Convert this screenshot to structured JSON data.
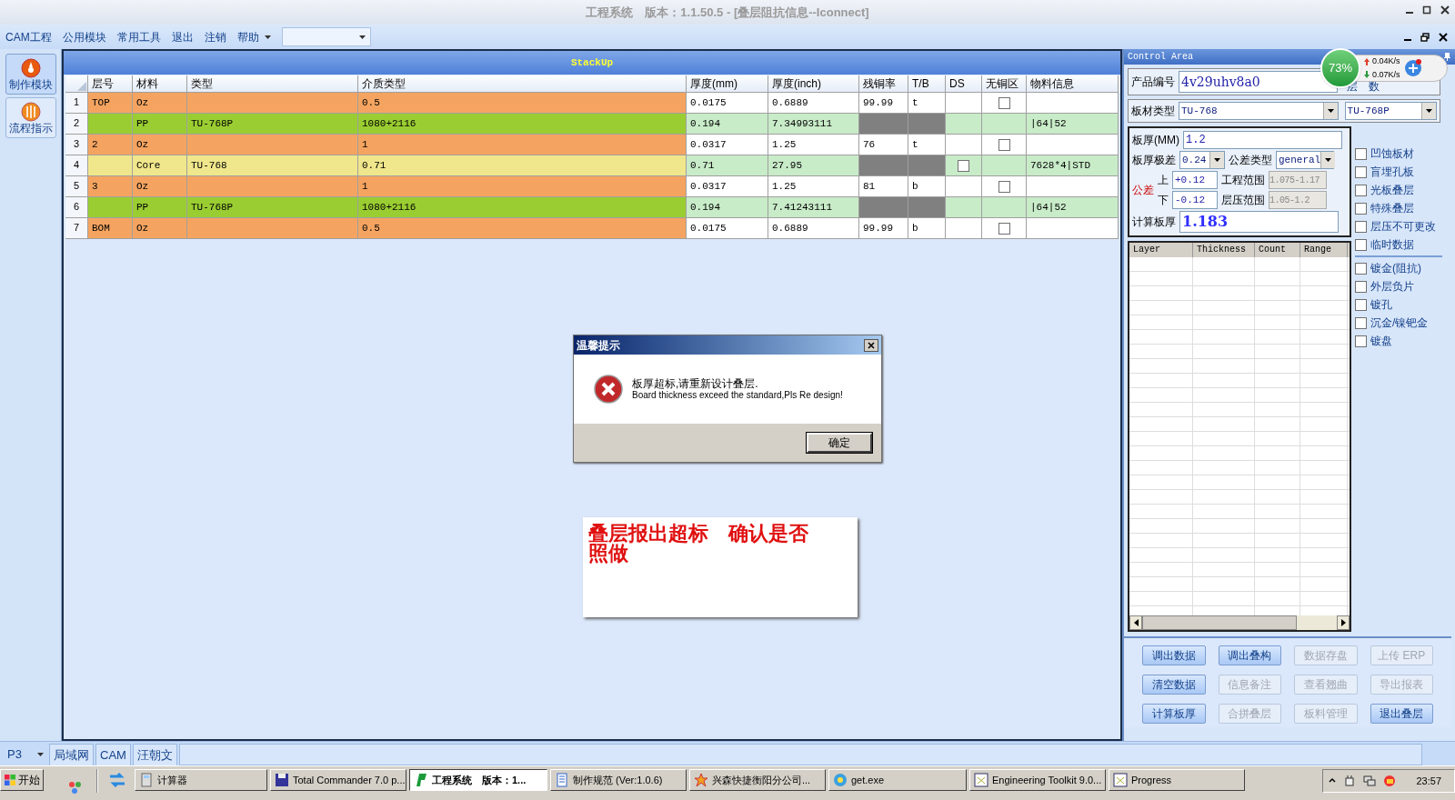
{
  "window": {
    "title": "工程系统　版本：1.1.50.5 - [叠层阻抗信息--Iconnect]"
  },
  "menu": [
    {
      "label": "CAM工程"
    },
    {
      "label": "公用模块"
    },
    {
      "label": "常用工具"
    },
    {
      "label": "退出"
    },
    {
      "label": "注销"
    },
    {
      "label": "帮助"
    }
  ],
  "sidebar": {
    "items": [
      {
        "label": "制作模块",
        "selected": true
      },
      {
        "label": "流程指示",
        "selected": false
      }
    ]
  },
  "stackup": {
    "title": "StackUp",
    "columns": [
      "层号",
      "材料",
      "类型",
      "介质类型",
      "厚度(mm)",
      "厚度(inch)",
      "残铜率",
      "T/B",
      "DS",
      "无铜区",
      "物料信息"
    ],
    "rows": [
      {
        "num": "1",
        "kind": "copper",
        "layer": "TOP",
        "material": "Oz",
        "type": "",
        "dielectric": "0.5",
        "thk_mm": "0.0175",
        "thk_inch": "0.6889",
        "residual": "99.99",
        "tb": "t",
        "material_info": "",
        "no_copper": {
          "checked": false
        }
      },
      {
        "num": "2",
        "kind": "prepreg",
        "layer": "",
        "material": "PP",
        "type": "TU-768P",
        "dielectric": "1080+2116",
        "thk_mm": "0.194",
        "thk_inch": "7.34993111",
        "residual": "",
        "tb": "",
        "material_info": "|64|52"
      },
      {
        "num": "3",
        "kind": "copper",
        "layer": "2",
        "material": "Oz",
        "type": "",
        "dielectric": "1",
        "thk_mm": "0.0317",
        "thk_inch": "1.25",
        "residual": "76",
        "tb": "t",
        "material_info": "",
        "no_copper": {
          "checked": false
        }
      },
      {
        "num": "4",
        "kind": "core",
        "layer": "",
        "material": "Core",
        "type": "TU-768",
        "dielectric": "0.71",
        "thk_mm": "0.71",
        "thk_inch": "27.95",
        "residual": "",
        "tb": "",
        "material_info": "7628*4|STD",
        "ds": {
          "checked": false
        }
      },
      {
        "num": "5",
        "kind": "copper",
        "layer": "3",
        "material": "Oz",
        "type": "",
        "dielectric": "1",
        "thk_mm": "0.0317",
        "thk_inch": "1.25",
        "residual": "81",
        "tb": "b",
        "material_info": "",
        "no_copper": {
          "checked": false
        }
      },
      {
        "num": "6",
        "kind": "prepreg",
        "layer": "",
        "material": "PP",
        "type": "TU-768P",
        "dielectric": "1080+2116",
        "thk_mm": "0.194",
        "thk_inch": "7.41243111",
        "residual": "",
        "tb": "",
        "material_info": "|64|52"
      },
      {
        "num": "7",
        "kind": "copper",
        "layer": "BOM",
        "material": "Oz",
        "type": "",
        "dielectric": "0.5",
        "thk_mm": "0.0175",
        "thk_inch": "0.6889",
        "residual": "99.99",
        "tb": "b",
        "material_info": "",
        "no_copper": {
          "checked": false
        }
      }
    ]
  },
  "dialog": {
    "title": "温馨提示",
    "message": "板厚超标,请重新设计叠层.",
    "message_en": "Board thickness exceed the standard,Pls Re design!",
    "button": "确定"
  },
  "note": {
    "text": "叠层报出超标　确认是否照做"
  },
  "control_area": {
    "title": "Control Area",
    "product_label": "产品编号",
    "product_value": "4v29uhv8a0",
    "layer_count_label": "层　数",
    "board_type_label": "板材类型",
    "board_type": "TU-768",
    "pp_type": "TU-768P",
    "thickness_label": "板厚(MM)",
    "thickness": "1.2",
    "range_label": "板厚极差",
    "range": "0.24",
    "tol_type_label": "公差类型",
    "tol_type": "general",
    "tol_label": "公差",
    "upper_label": "上",
    "upper": "+0.12",
    "eng_range_label": "工程范围",
    "eng_range": "1.075-1.17",
    "lower_label": "下",
    "lower": "-0.12",
    "press_range_label": "层压范围",
    "press_range": "1.05-1.2",
    "calc_label": "计算板厚",
    "calc_value": "1.183",
    "options": [
      {
        "label": "凹蚀板材",
        "checked": false
      },
      {
        "label": "盲埋孔板",
        "checked": false
      },
      {
        "label": "光板叠层",
        "checked": false
      },
      {
        "label": "特殊叠层",
        "checked": false
      },
      {
        "label": "层压不可更改",
        "checked": false
      },
      {
        "label": "临时数据",
        "checked": false
      }
    ],
    "options2": [
      {
        "label": "镀金(阻抗)",
        "checked": false
      },
      {
        "label": "外层负片",
        "checked": false
      },
      {
        "label": "镀孔",
        "checked": false
      },
      {
        "label": "沉金/镍钯金",
        "checked": false
      },
      {
        "label": "镀盘",
        "checked": false
      }
    ],
    "grid_columns": [
      "Layer",
      "Thickness",
      "Count",
      "Range"
    ],
    "buttons": [
      {
        "label": "调出数据",
        "disabled": false
      },
      {
        "label": "调出叠构",
        "disabled": false
      },
      {
        "label": "数据存盘",
        "disabled": true
      },
      {
        "label": "上传 ERP",
        "disabled": true
      },
      {
        "label": "清空数据",
        "disabled": false
      },
      {
        "label": "信息备注",
        "disabled": true
      },
      {
        "label": "查看翘曲",
        "disabled": true
      },
      {
        "label": "导出报表",
        "disabled": true
      },
      {
        "label": "计算板厚",
        "disabled": false
      },
      {
        "label": "合拼叠层",
        "disabled": true
      },
      {
        "label": "板料管理",
        "disabled": true
      },
      {
        "label": "退出叠层",
        "disabled": false
      }
    ]
  },
  "net_widget": {
    "percent": "73%",
    "up": "0.04K/s",
    "down": "0.07K/s"
  },
  "bottom_bar": {
    "selector": "P3",
    "tabs": [
      {
        "label": "局域网"
      },
      {
        "label": "CAM"
      },
      {
        "label": "汪朝文"
      }
    ]
  },
  "taskbar": {
    "start": "开始",
    "tasks": [
      {
        "label": "计算器",
        "selected": false
      },
      {
        "label": "Total Commander 7.0 p...",
        "selected": false
      },
      {
        "label": "工程系统　版本：1...",
        "selected": true
      },
      {
        "label": "制作规范 (Ver:1.0.6)",
        "selected": false
      },
      {
        "label": "兴森快捷衡阳分公司...",
        "selected": false
      },
      {
        "label": "get.exe",
        "selected": false
      },
      {
        "label": "Engineering Toolkit 9.0...",
        "selected": false
      },
      {
        "label": "Progress",
        "selected": false
      }
    ],
    "clock": "23:57"
  }
}
